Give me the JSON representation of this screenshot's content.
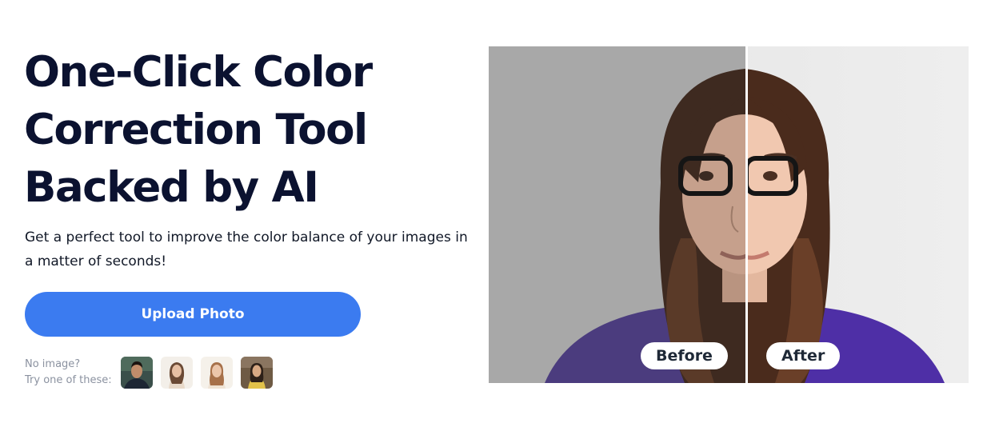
{
  "hero": {
    "title_lines": [
      "One-Click Color",
      "Correction Tool",
      "Backed by AI"
    ],
    "subtitle": "Get a perfect tool to improve the color balance of your images in a matter of seconds!"
  },
  "upload": {
    "label": "Upload Photo"
  },
  "samples": {
    "line1": "No image?",
    "line2": "Try one of these:",
    "thumbnails": [
      {
        "icon": "man-portrait-thumbnail"
      },
      {
        "icon": "woman-portrait-thumbnail"
      },
      {
        "icon": "woman-portrait-thumbnail"
      },
      {
        "icon": "woman-yellow-portrait-thumbnail"
      }
    ]
  },
  "comparison": {
    "before_label": "Before",
    "after_label": "After"
  },
  "colors": {
    "accent": "#3b7bf0",
    "heading": "#0b1230",
    "muted": "#8b92a0"
  }
}
